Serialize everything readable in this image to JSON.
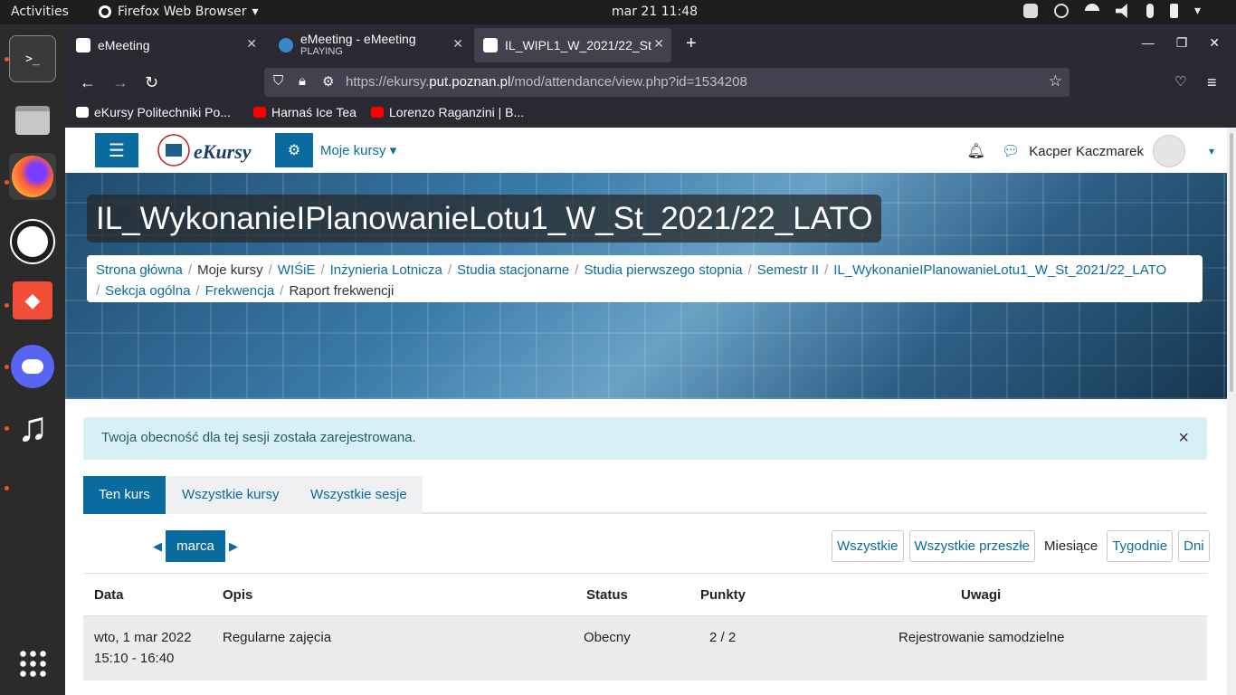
{
  "system": {
    "activities": "Activities",
    "app_name": "Firefox Web Browser",
    "clock": "mar 21  11:48"
  },
  "browser": {
    "tabs": [
      {
        "title": "eMeeting",
        "subtitle": ""
      },
      {
        "title": "eMeeting - eMeeting",
        "subtitle": "PLAYING"
      },
      {
        "title": "IL_WIPL1_W_2021/22_St",
        "subtitle": ""
      }
    ],
    "url_prefix": "https://ekursy.",
    "url_domain": "put.poznan.pl",
    "url_path": "/mod/attendance/view.php?id=1534208",
    "bookmarks": [
      {
        "label": "eKursy Politechniki Po..."
      },
      {
        "label": "Harnaś Ice Tea"
      },
      {
        "label": "Lorenzo Raganzini | B..."
      }
    ]
  },
  "site": {
    "logo_text": "eKursy",
    "my_courses": "Moje kursy",
    "user_name": "Kacper Kaczmarek"
  },
  "course": {
    "title": "IL_WykonanieIPlanowanieLotu1_W_St_2021/22_LATO",
    "breadcrumb": [
      "Strona główna",
      "Moje kursy",
      "WIŚiE",
      "Inżynieria Lotnicza",
      "Studia stacjonarne",
      "Studia pierwszego stopnia",
      "Semestr II",
      "IL_WykonanieIPlanowanieLotu1_W_St_2021/22_LATO",
      "Sekcja ogólna",
      "Frekwencja",
      "Raport frekwencji"
    ]
  },
  "alert": {
    "text": "Twoja obecność dla tej sesji została zarejestrowana.",
    "close": "×"
  },
  "tabs": [
    "Ten kurs",
    "Wszystkie kursy",
    "Wszystkie sesje"
  ],
  "month": "marca",
  "filters": {
    "all": "Wszystkie",
    "all_past": "Wszystkie przeszłe",
    "months": "Miesiące",
    "weeks": "Tygodnie",
    "days": "Dni"
  },
  "table": {
    "headers": {
      "date": "Data",
      "desc": "Opis",
      "status": "Status",
      "points": "Punkty",
      "notes": "Uwagi"
    },
    "rows": [
      {
        "date": "wto, 1 mar 2022",
        "time": "15:10 - 16:40",
        "desc": "Regularne zajęcia",
        "status": "Obecny",
        "points": "2 / 2",
        "notes": "Rejestrowanie samodzielne"
      }
    ]
  },
  "colors": {
    "accent": "#0a6b9f",
    "alert_bg": "#d6f0f5"
  }
}
